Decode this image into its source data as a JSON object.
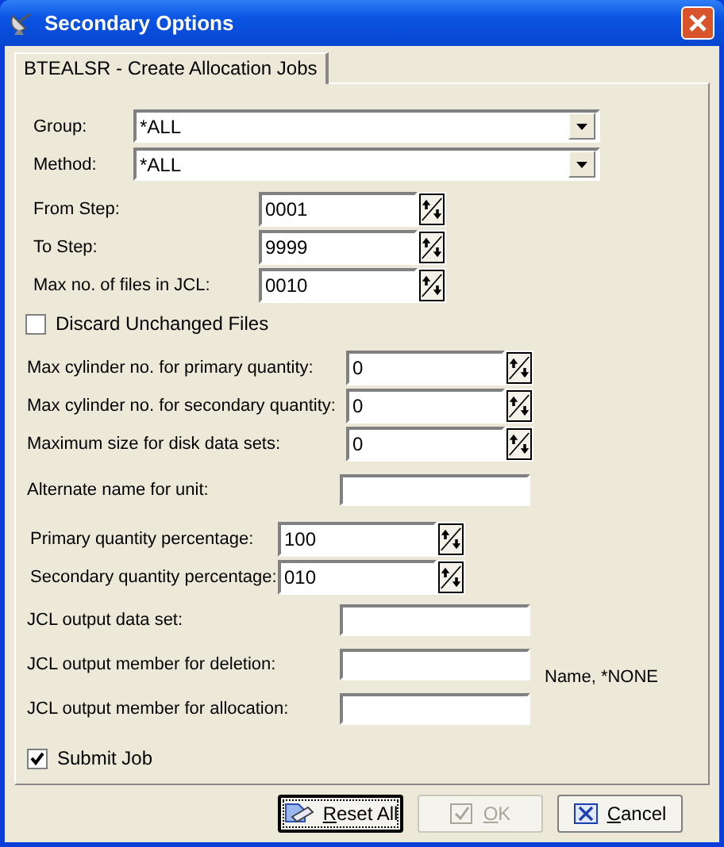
{
  "window": {
    "title": "Secondary Options"
  },
  "tabs": [
    {
      "label": "BTEALSR - Create Allocation Jobs",
      "selected": true
    }
  ],
  "combos": [
    {
      "label": "Group:",
      "value": "*ALL"
    },
    {
      "label": "Method:",
      "value": "*ALL"
    }
  ],
  "step_fields": [
    {
      "label": "From Step:",
      "value": "0001"
    },
    {
      "label": "To Step:",
      "value": "9999"
    },
    {
      "label": "Max no. of files in JCL:",
      "value": "0010"
    }
  ],
  "discard_unchanged": {
    "label": "Discard Unchanged Files",
    "checked": false
  },
  "cylinder_fields": [
    {
      "label": "Max cylinder no. for primary quantity:",
      "value": "0"
    },
    {
      "label": "Max cylinder no. for secondary quantity:",
      "value": "0"
    },
    {
      "label": "Maximum size for disk data sets:",
      "value": "0"
    }
  ],
  "alternate_unit": {
    "label": "Alternate name for unit:"
  },
  "percentage_fields": [
    {
      "label": "Primary quantity percentage:",
      "value": "100"
    },
    {
      "label": "Secondary quantity percentage:",
      "value": "010"
    }
  ],
  "jcl_fields": [
    {
      "label": "JCL output data set:"
    },
    {
      "label": "JCL output member for deletion:",
      "note": "Name, *NONE"
    },
    {
      "label": "JCL output member for allocation:"
    }
  ],
  "submit_job": {
    "label": "Submit Job",
    "checked": true
  },
  "buttons": [
    {
      "label": "Reset All",
      "kind": "reset",
      "disabled": false,
      "selected": true
    },
    {
      "label": "OK",
      "kind": "ok",
      "disabled": true,
      "selected": false
    },
    {
      "label": "Cancel",
      "kind": "cancel",
      "disabled": false,
      "selected": false
    }
  ]
}
